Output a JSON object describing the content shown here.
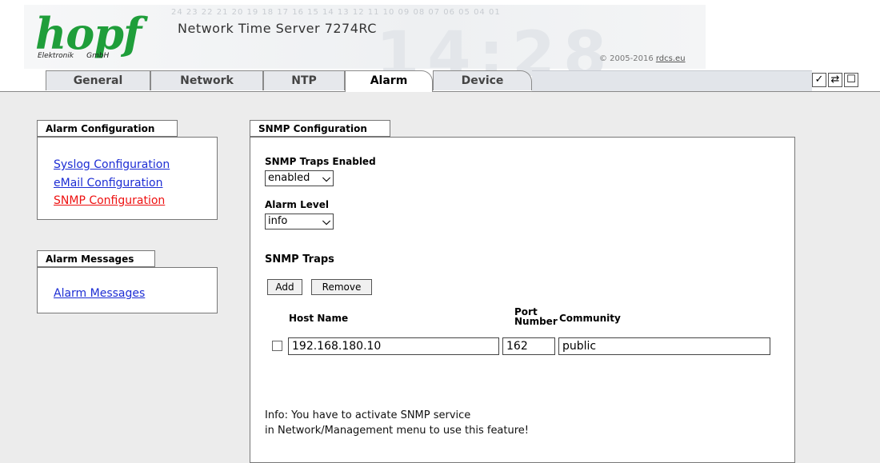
{
  "header": {
    "logo_text": "hopf",
    "logo_sub_left": "Elektronik",
    "logo_sub_right": "GmbH",
    "number_strip": "24 23 22 21 20 19 18 17 16 15 14 13 12 11 10 09 08 07 06 05 04 01",
    "product_title": "Network Time Server 7274RC",
    "copyright_prefix": "© 2005-2016 ",
    "copyright_link": "rdcs.eu",
    "background_digits": "14:28"
  },
  "tabs": [
    "General",
    "Network",
    "NTP",
    "Alarm",
    "Device"
  ],
  "active_tab": "Alarm",
  "toolbar_icons": [
    "check-icon",
    "reload-icon",
    "page-icon"
  ],
  "sidebar": {
    "alarm_config_title": "Alarm Configuration",
    "alarm_config_links": [
      "Syslog Configuration",
      "eMail Configuration",
      "SNMP Configuration"
    ],
    "alarm_messages_title": "Alarm Messages",
    "alarm_messages_links": [
      "Alarm Messages"
    ]
  },
  "snmp": {
    "panel_title": "SNMP Configuration",
    "traps_enabled_label": "SNMP Traps Enabled",
    "traps_enabled_value": "enabled",
    "alarm_level_label": "Alarm Level",
    "alarm_level_value": "info",
    "traps_heading": "SNMP Traps",
    "add_label": "Add",
    "remove_label": "Remove",
    "col_host": "Host Name",
    "col_port_line1": "Port",
    "col_port_line2": "Number",
    "col_community": "Community",
    "rows": [
      {
        "host": "192.168.180.10",
        "port": "162",
        "community": "public"
      }
    ],
    "info_line1": "Info: You have to activate SNMP service",
    "info_line2": "in Network/Management menu to use this feature!"
  },
  "colors": {
    "logo_green": "#1f9e3a",
    "link_blue": "#1d2dd4",
    "link_active_red": "#ee1111",
    "content_bg": "#ececec"
  }
}
